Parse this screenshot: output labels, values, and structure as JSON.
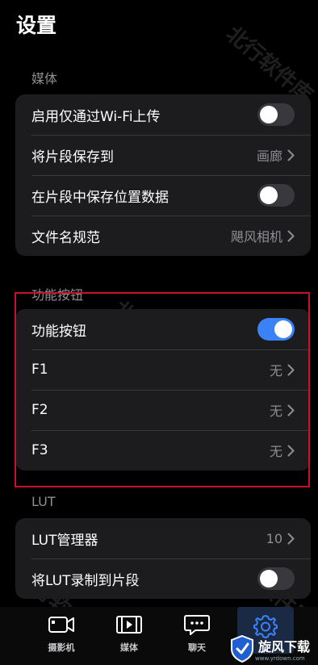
{
  "page": {
    "title": "设置"
  },
  "media": {
    "header": "媒体",
    "rows": [
      {
        "label": "启用仅通过Wi-Fi上传",
        "toggle": false
      },
      {
        "label": "将片段保存到",
        "value": "画廊"
      },
      {
        "label": "在片段中保存位置数据",
        "toggle": false
      },
      {
        "label": "文件名规范",
        "value": "飓风相机"
      }
    ]
  },
  "function_buttons": {
    "header": "功能按钮",
    "rows": [
      {
        "label": "功能按钮",
        "toggle": true
      },
      {
        "label": "F1",
        "value": "无"
      },
      {
        "label": "F2",
        "value": "无"
      },
      {
        "label": "F3",
        "value": "无"
      }
    ]
  },
  "lut": {
    "header": "LUT",
    "rows": [
      {
        "label": "LUT管理器",
        "value": "10"
      },
      {
        "label": "将LUT录制到片段",
        "toggle": false
      }
    ]
  },
  "tabbar": {
    "tabs": [
      {
        "label": "摄影机",
        "icon": "camera-icon"
      },
      {
        "label": "媒体",
        "icon": "film-icon"
      },
      {
        "label": "聊天",
        "icon": "chat-icon"
      },
      {
        "label": "",
        "icon": "gear-icon",
        "active": true
      }
    ]
  },
  "watermark": {
    "text": "北行软件库"
  },
  "logo": {
    "text": "旋风下载",
    "url_text": "www.yrdown.com"
  },
  "colors": {
    "accent": "#3a82f7",
    "highlight": "#c8102e",
    "background": "#000000",
    "group": "#1c1c1e"
  }
}
